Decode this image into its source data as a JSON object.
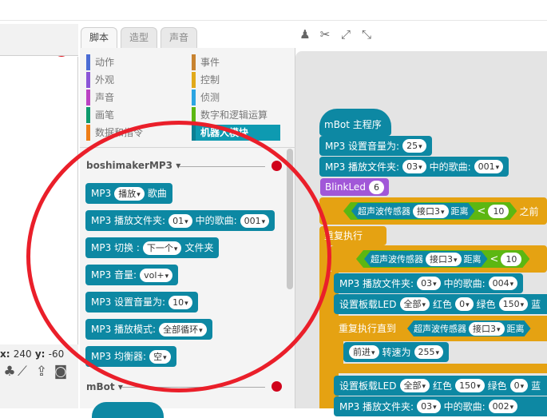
{
  "stage": {
    "x_label": "x:",
    "x_value": "240",
    "y_label": "y:",
    "y_value": "-60"
  },
  "tabs": [
    "脚本",
    "造型",
    "声音"
  ],
  "categories": [
    {
      "label": "动作",
      "color": "#4a6cd4"
    },
    {
      "label": "事件",
      "color": "#c88330"
    },
    {
      "label": "外观",
      "color": "#8a55d7"
    },
    {
      "label": "控制",
      "color": "#e1a91a"
    },
    {
      "label": "声音",
      "color": "#bb42c3"
    },
    {
      "label": "侦测",
      "color": "#2ca5e2"
    },
    {
      "label": "画笔",
      "color": "#0e9a6c"
    },
    {
      "label": "数字和逻辑运算",
      "color": "#5cb712"
    },
    {
      "label": "数据和指令",
      "color": "#ee7d16"
    },
    {
      "label": "机器人模块",
      "color": "#0e9ab1"
    }
  ],
  "palette": {
    "section_title": "boshimakerMP3",
    "section2_title": "mBot",
    "blocks": [
      {
        "parts": [
          "MP3",
          {
            "pill": "播放"
          },
          "歌曲"
        ]
      },
      {
        "parts": [
          "MP3 播放文件夹:",
          {
            "pill": "01"
          },
          "中的歌曲:",
          {
            "pill": "001"
          }
        ]
      },
      {
        "parts": [
          "MP3 切换 :",
          {
            "pill": "下一个"
          },
          "文件夹"
        ]
      },
      {
        "parts": [
          "MP3 音量:",
          {
            "pill": "vol+"
          }
        ]
      },
      {
        "parts": [
          "MP3 设置音量为:",
          {
            "pill": "10"
          }
        ]
      },
      {
        "parts": [
          "MP3 播放模式:",
          {
            "pill": "全部循环"
          }
        ]
      },
      {
        "parts": [
          "MP3 均衡器:",
          {
            "pill": "空"
          }
        ]
      }
    ]
  },
  "script": {
    "hat_label": "mBot 主程序",
    "set_volume": {
      "text": "MP3 设置音量为:",
      "value": "25"
    },
    "play_folder": {
      "text1": "MP3 播放文件夹:",
      "folder": "03",
      "text2": "中的歌曲:",
      "song": "001"
    },
    "blinkled": {
      "text": "BlinkLed",
      "value": "6"
    },
    "if1": {
      "sensor": "超声波传感器",
      "port": "接口3",
      "dist": "距离",
      "op": "<",
      "value": "10",
      "trail": "之前"
    },
    "forever_label": "重复执行",
    "if2": {
      "sensor": "超声波传感器",
      "port": "接口3",
      "dist": "距离",
      "op": "<",
      "value": "10"
    },
    "play_folder2": {
      "text1": "MP3 播放文件夹:",
      "folder": "03",
      "text2": "中的歌曲:",
      "song": "004"
    },
    "set_led1": {
      "text1": "设置板载LED",
      "which": "全部",
      "r_label": "红色",
      "r": "0",
      "g_label": "绿色",
      "g": "150",
      "b_label": "蓝"
    },
    "repeat_until": {
      "text": "重复执行直到",
      "sensor": "超声波传感器",
      "port": "接口3",
      "dist": "距离"
    },
    "forward": {
      "dir": "前进",
      "text": "转速为",
      "speed": "255"
    },
    "set_led2": {
      "text1": "设置板载LED",
      "which": "全部",
      "r_label": "红色",
      "r": "150",
      "g_label": "绿色",
      "g": "0",
      "b_label": "蓝"
    },
    "play_folder3": {
      "text1": "MP3 播放文件夹:",
      "folder": "03",
      "text2": "中的歌曲:",
      "song": "002"
    }
  }
}
